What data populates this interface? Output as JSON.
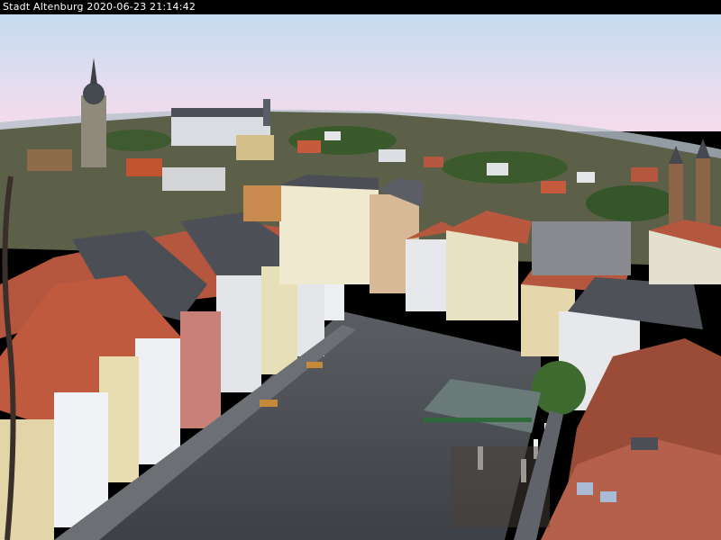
{
  "caption": {
    "text": "Stadt Altenburg 2020-06-23 21:14:42"
  },
  "scene": {
    "colors": {
      "sky_top": "#c9dff0",
      "sky_horizon": "#f3dcef",
      "haze": "#d6dde8",
      "square_pavement": "#4a4f56",
      "roof_red": "#b5573e",
      "roof_slate": "#4b4e55",
      "facade_white": "#e4e6ea",
      "facade_cream": "#d8c9a4",
      "tree_green": "#3a5a2c"
    }
  }
}
